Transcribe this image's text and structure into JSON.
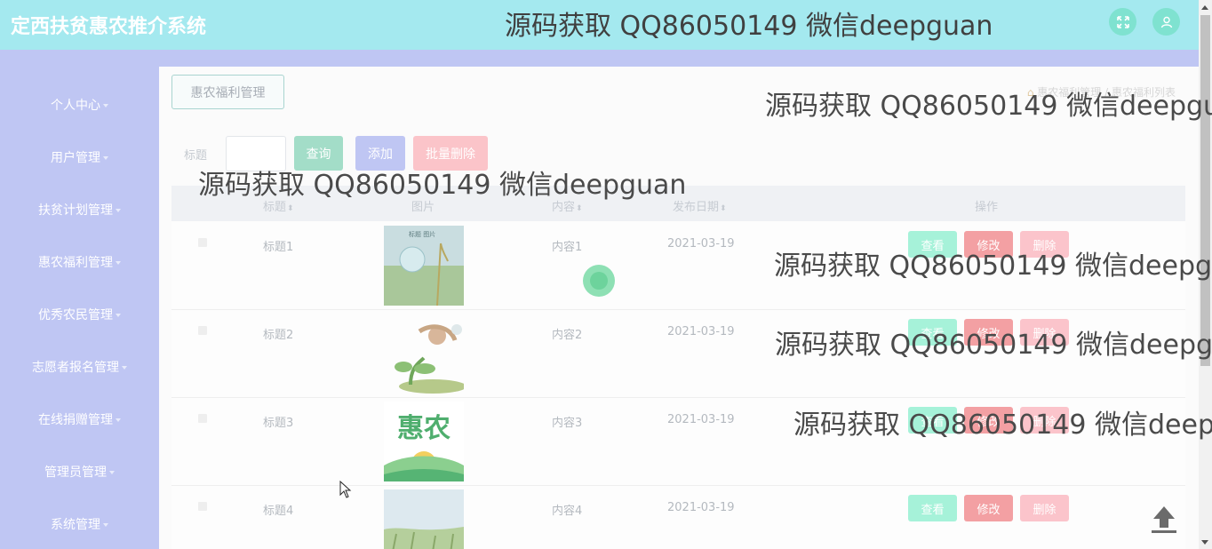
{
  "header": {
    "app_title": "定西扶贫惠农推介系统",
    "watermark": "源码获取 QQ86050149 微信deepguan",
    "fullscreen_icon": "fullscreen-icon",
    "user_icon": "user-avatar-icon"
  },
  "sidebar": {
    "items": [
      {
        "label": "个人中心"
      },
      {
        "label": "用户管理"
      },
      {
        "label": "扶贫计划管理"
      },
      {
        "label": "惠农福利管理"
      },
      {
        "label": "优秀农民管理"
      },
      {
        "label": "志愿者报名管理"
      },
      {
        "label": "在线捐赠管理"
      },
      {
        "label": "管理员管理"
      },
      {
        "label": "系统管理"
      }
    ]
  },
  "main": {
    "page_tag": "惠农福利管理",
    "breadcrumb": [
      "惠农福利管理",
      "惠农福利列表"
    ],
    "search": {
      "label": "标题",
      "value": ""
    },
    "buttons": {
      "query": "查询",
      "add": "添加",
      "batch_delete": "批量删除"
    },
    "watermarks": [
      "源码获取 QQ86050149 微信deepgua",
      "源码获取 QQ86050149 微信deepguan",
      "源码获取 QQ86050149 微信deepgu",
      "源码获取 QQ86050149 微信deepgu",
      "源码获取 QQ86050149 微信deepg"
    ],
    "table": {
      "columns": {
        "title": "标题",
        "image": "图片",
        "content": "内容",
        "date": "发布日期",
        "actions": "操作"
      },
      "rows": [
        {
          "title": "标题1",
          "content": "内容1",
          "date": "2021-03-19"
        },
        {
          "title": "标题2",
          "content": "内容2",
          "date": "2021-03-19"
        },
        {
          "title": "标题3",
          "content": "内容3",
          "date": "2021-03-19",
          "image_text": "惠农"
        },
        {
          "title": "标题4",
          "content": "内容4",
          "date": "2021-03-19"
        }
      ],
      "actions": {
        "view": "查看",
        "edit": "修改",
        "delete": "删除"
      }
    }
  }
}
